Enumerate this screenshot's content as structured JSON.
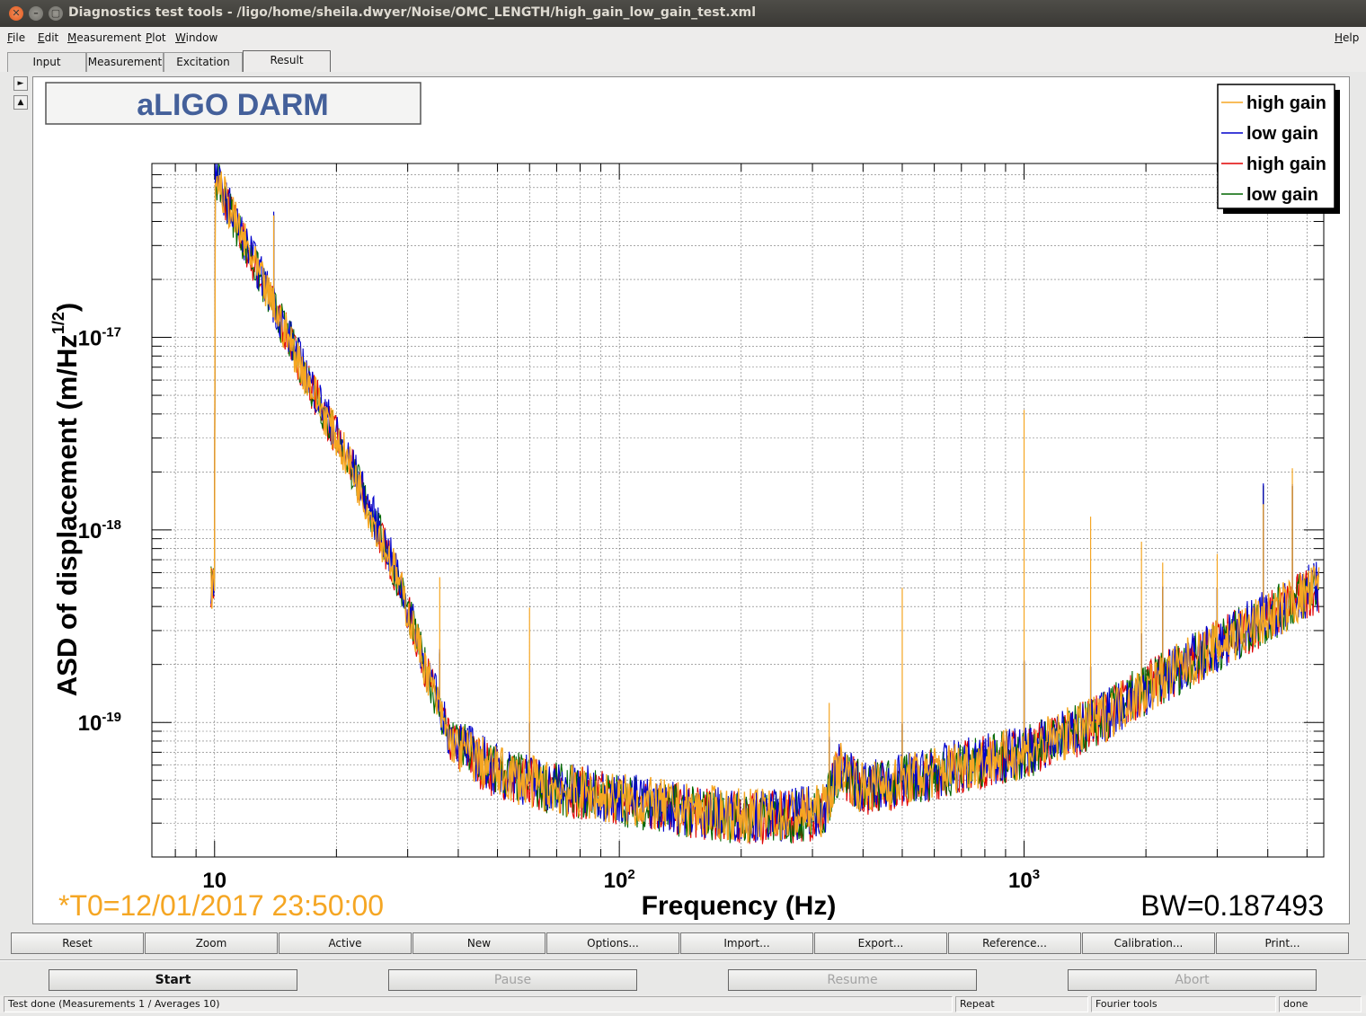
{
  "window": {
    "title": "Diagnostics test tools - /ligo/home/sheila.dwyer/Noise/OMC_LENGTH/high_gain_low_gain_test.xml"
  },
  "menu": {
    "items": [
      {
        "u": "F",
        "rest": "ile"
      },
      {
        "u": "E",
        "rest": "dit"
      },
      {
        "u": "M",
        "rest": "easurement"
      },
      {
        "u": "P",
        "rest": "lot"
      },
      {
        "u": "W",
        "rest": "indow"
      }
    ],
    "help": {
      "u": "H",
      "rest": "elp"
    }
  },
  "tabs": [
    "Input",
    "Measurement",
    "Excitation",
    "Result"
  ],
  "pad_arrows": [
    "►",
    "▲"
  ],
  "plot": {
    "title": "aLIGO DARM",
    "xlabel": "Frequency (Hz)",
    "ylabel_main": "ASD of displacement (m/Hz",
    "ylabel_sup": "1/2",
    "ylabel_close": ")",
    "t0": "*T0=12/01/2017 23:50:00",
    "bw": "BW=0.187493",
    "x_ticks": [
      {
        "base": "10",
        "exp": "",
        "value": 10
      },
      {
        "base": "10",
        "exp": "2",
        "value": 100
      },
      {
        "base": "10",
        "exp": "3",
        "value": 1000
      }
    ],
    "y_ticks": [
      {
        "base": "10",
        "exp": "-17",
        "value": 1e-17
      },
      {
        "base": "10",
        "exp": "-18",
        "value": 1e-18
      },
      {
        "base": "10",
        "exp": "-19",
        "value": 1e-19
      }
    ],
    "colors": {
      "high_gain_1": "#f5a623",
      "low_gain_1": "#0000cc",
      "high_gain_2": "#e00000",
      "low_gain_2": "#006600"
    }
  },
  "chart_data": {
    "type": "line",
    "title": "aLIGO DARM",
    "xlabel": "Frequency (Hz)",
    "ylabel": "ASD of displacement (m/Hz^1/2)",
    "x_scale": "log",
    "y_scale": "log",
    "xlim": [
      7,
      5500
    ],
    "ylim": [
      2e-20,
      8e-17
    ],
    "grid": true,
    "legend_position": "top-right",
    "series": [
      {
        "name": "high gain",
        "color": "#f5a623",
        "x": [
          10,
          13,
          17,
          22,
          28,
          33,
          38,
          50,
          70,
          100,
          150,
          200,
          260,
          320,
          350,
          400,
          500,
          700,
          1000,
          1500,
          2000,
          3000,
          4000,
          5300
        ],
        "y": [
          7e-17,
          2e-17,
          6e-18,
          2e-18,
          6e-19,
          2e-19,
          8e-20,
          5.5e-20,
          4.5e-20,
          4e-20,
          3.5e-20,
          3.3e-20,
          3.3e-20,
          3.5e-20,
          6e-20,
          4.5e-20,
          5e-20,
          6e-20,
          7e-20,
          1e-19,
          1.5e-19,
          2.5e-19,
          3.5e-19,
          5e-19
        ]
      },
      {
        "name": "low gain",
        "color": "#0000cc",
        "x": [
          10,
          13,
          17,
          22,
          28,
          33,
          38,
          50,
          70,
          100,
          150,
          200,
          260,
          320,
          350,
          400,
          500,
          700,
          1000,
          1500,
          2000,
          3000,
          4000,
          5300
        ],
        "y": [
          7e-17,
          2.1e-17,
          6.2e-18,
          2.1e-18,
          6.2e-19,
          2.1e-19,
          8.5e-20,
          5.6e-20,
          4.6e-20,
          4.1e-20,
          3.5e-20,
          3.3e-20,
          3.3e-20,
          3.5e-20,
          6e-20,
          4.6e-20,
          5e-20,
          6e-20,
          7e-20,
          1e-19,
          1.5e-19,
          2.5e-19,
          3.6e-19,
          5.2e-19
        ]
      },
      {
        "name": "high gain",
        "color": "#e00000",
        "x": [
          10,
          13,
          17,
          22,
          28,
          33,
          38,
          50,
          70,
          100,
          150,
          200,
          260,
          320,
          350,
          400,
          500,
          700,
          1000,
          1500,
          2000,
          3000,
          4000,
          5300
        ],
        "y": [
          6.8e-17,
          2e-17,
          6e-18,
          2e-18,
          6e-19,
          2e-19,
          8e-20,
          5.4e-20,
          4.5e-20,
          4e-20,
          3.4e-20,
          3.2e-20,
          3.2e-20,
          3.4e-20,
          5.8e-20,
          4.5e-20,
          4.9e-20,
          5.9e-20,
          6.9e-20,
          1e-19,
          1.5e-19,
          2.5e-19,
          3.5e-19,
          5.1e-19
        ]
      },
      {
        "name": "low gain",
        "color": "#006600",
        "x": [
          10,
          13,
          17,
          22,
          28,
          33,
          38,
          50,
          70,
          100,
          150,
          200,
          260,
          320,
          350,
          400,
          500,
          700,
          1000,
          1500,
          2000,
          3000,
          4000,
          5300
        ],
        "y": [
          6.9e-17,
          2e-17,
          6.1e-18,
          2e-18,
          6.1e-19,
          2e-19,
          8.2e-20,
          5.5e-20,
          4.5e-20,
          4e-20,
          3.4e-20,
          3.2e-20,
          3.2e-20,
          3.4e-20,
          5.9e-20,
          4.5e-20,
          4.9e-20,
          5.9e-20,
          6.9e-20,
          1e-19,
          1.5e-19,
          2.5e-19,
          3.5e-19,
          5.1e-19
        ]
      }
    ],
    "peaks_hz": [
      14,
      36,
      60,
      330,
      500,
      1000,
      1460,
      1950,
      2200,
      3000,
      3900,
      4600
    ]
  },
  "plot_buttons": [
    "Reset",
    "Zoom",
    "Active",
    "New",
    "Options...",
    "Import...",
    "Export...",
    "Reference...",
    "Calibration...",
    "Print..."
  ],
  "controls": {
    "start": "Start",
    "pause": "Pause",
    "resume": "Resume",
    "abort": "Abort"
  },
  "status": {
    "main": "Test done (Measurements 1 / Averages 10)",
    "repeat": "Repeat",
    "tool": "Fourier tools",
    "state": "done"
  }
}
